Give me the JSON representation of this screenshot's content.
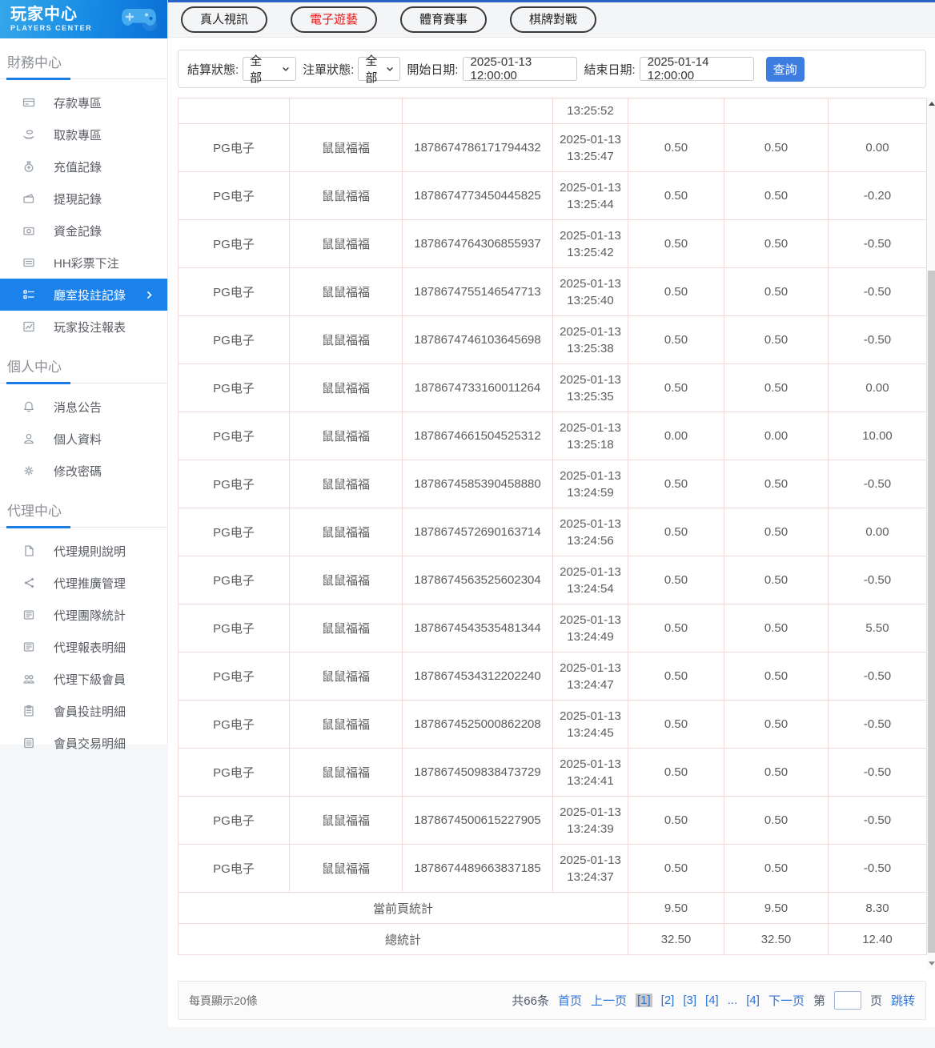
{
  "sidebar": {
    "title": "玩家中心",
    "subtitle": "PLAYERS CENTER",
    "logo_icon": "game-controller-icon",
    "sections": [
      {
        "label": "財務中心",
        "items": [
          {
            "icon": "deposit-card-icon",
            "label": "存款專區",
            "selected": false
          },
          {
            "icon": "withdraw-hand-icon",
            "label": "取款專區",
            "selected": false
          },
          {
            "icon": "recharge-bag-icon",
            "label": "充值記錄",
            "selected": false
          },
          {
            "icon": "withdraw-record-icon",
            "label": "提現記錄",
            "selected": false
          },
          {
            "icon": "funds-record-icon",
            "label": "資金記錄",
            "selected": false
          },
          {
            "icon": "lottery-bet-icon",
            "label": "HH彩票下注",
            "selected": false
          },
          {
            "icon": "bet-record-icon",
            "label": "廳室投註記錄",
            "selected": true
          },
          {
            "icon": "report-chart-icon",
            "label": "玩家投注報表",
            "selected": false
          }
        ]
      },
      {
        "label": "個人中心",
        "items": [
          {
            "icon": "bell-icon",
            "label": "消息公告",
            "selected": false
          },
          {
            "icon": "person-icon",
            "label": "個人資料",
            "selected": false
          },
          {
            "icon": "gear-icon",
            "label": "修改密碼",
            "selected": false
          }
        ]
      },
      {
        "label": "代理中心",
        "items": [
          {
            "icon": "doc-icon",
            "label": "代理規則說明",
            "selected": false
          },
          {
            "icon": "share-icon",
            "label": "代理推廣管理",
            "selected": false
          },
          {
            "icon": "news-icon",
            "label": "代理團隊統計",
            "selected": false
          },
          {
            "icon": "news-icon",
            "label": "代理報表明細",
            "selected": false
          },
          {
            "icon": "users-icon",
            "label": "代理下級會員",
            "selected": false
          },
          {
            "icon": "clipboard-icon",
            "label": "會員投註明細",
            "selected": false
          },
          {
            "icon": "clipboard2-icon",
            "label": "會員交易明細",
            "selected": false
          }
        ]
      }
    ]
  },
  "tabs": [
    {
      "label": "真人視訊",
      "active": false
    },
    {
      "label": "電子遊藝",
      "active": true
    },
    {
      "label": "體育賽事",
      "active": false
    },
    {
      "label": "棋牌對戰",
      "active": false
    }
  ],
  "filters": {
    "settle_status_label": "結算狀態:",
    "settle_status_value": "全部",
    "order_status_label": "注單狀態:",
    "order_status_value": "全部",
    "start_date_label": "開始日期:",
    "start_date_value": "2025-01-13 12:00:00",
    "end_date_label": "結束日期:",
    "end_date_value": "2025-01-14 12:00:00",
    "search_button": "查詢"
  },
  "table": {
    "partial_row_time": "13:25:52",
    "rows": [
      {
        "game": "PG电子",
        "name": "鼠鼠福福",
        "order_id": "1878674786171794432",
        "date": "2025-01-13",
        "time": "13:25:47",
        "bet": "0.50",
        "valid": "0.50",
        "win": "0.00"
      },
      {
        "game": "PG电子",
        "name": "鼠鼠福福",
        "order_id": "1878674773450445825",
        "date": "2025-01-13",
        "time": "13:25:44",
        "bet": "0.50",
        "valid": "0.50",
        "win": "-0.20"
      },
      {
        "game": "PG电子",
        "name": "鼠鼠福福",
        "order_id": "1878674764306855937",
        "date": "2025-01-13",
        "time": "13:25:42",
        "bet": "0.50",
        "valid": "0.50",
        "win": "-0.50"
      },
      {
        "game": "PG电子",
        "name": "鼠鼠福福",
        "order_id": "1878674755146547713",
        "date": "2025-01-13",
        "time": "13:25:40",
        "bet": "0.50",
        "valid": "0.50",
        "win": "-0.50"
      },
      {
        "game": "PG电子",
        "name": "鼠鼠福福",
        "order_id": "1878674746103645698",
        "date": "2025-01-13",
        "time": "13:25:38",
        "bet": "0.50",
        "valid": "0.50",
        "win": "-0.50"
      },
      {
        "game": "PG电子",
        "name": "鼠鼠福福",
        "order_id": "1878674733160011264",
        "date": "2025-01-13",
        "time": "13:25:35",
        "bet": "0.50",
        "valid": "0.50",
        "win": "0.00"
      },
      {
        "game": "PG电子",
        "name": "鼠鼠福福",
        "order_id": "1878674661504525312",
        "date": "2025-01-13",
        "time": "13:25:18",
        "bet": "0.00",
        "valid": "0.00",
        "win": "10.00"
      },
      {
        "game": "PG电子",
        "name": "鼠鼠福福",
        "order_id": "1878674585390458880",
        "date": "2025-01-13",
        "time": "13:24:59",
        "bet": "0.50",
        "valid": "0.50",
        "win": "-0.50"
      },
      {
        "game": "PG电子",
        "name": "鼠鼠福福",
        "order_id": "1878674572690163714",
        "date": "2025-01-13",
        "time": "13:24:56",
        "bet": "0.50",
        "valid": "0.50",
        "win": "0.00"
      },
      {
        "game": "PG电子",
        "name": "鼠鼠福福",
        "order_id": "1878674563525602304",
        "date": "2025-01-13",
        "time": "13:24:54",
        "bet": "0.50",
        "valid": "0.50",
        "win": "-0.50"
      },
      {
        "game": "PG电子",
        "name": "鼠鼠福福",
        "order_id": "1878674543535481344",
        "date": "2025-01-13",
        "time": "13:24:49",
        "bet": "0.50",
        "valid": "0.50",
        "win": "5.50"
      },
      {
        "game": "PG电子",
        "name": "鼠鼠福福",
        "order_id": "1878674534312202240",
        "date": "2025-01-13",
        "time": "13:24:47",
        "bet": "0.50",
        "valid": "0.50",
        "win": "-0.50"
      },
      {
        "game": "PG电子",
        "name": "鼠鼠福福",
        "order_id": "1878674525000862208",
        "date": "2025-01-13",
        "time": "13:24:45",
        "bet": "0.50",
        "valid": "0.50",
        "win": "-0.50"
      },
      {
        "game": "PG电子",
        "name": "鼠鼠福福",
        "order_id": "1878674509838473729",
        "date": "2025-01-13",
        "time": "13:24:41",
        "bet": "0.50",
        "valid": "0.50",
        "win": "-0.50"
      },
      {
        "game": "PG电子",
        "name": "鼠鼠福福",
        "order_id": "1878674500615227905",
        "date": "2025-01-13",
        "time": "13:24:39",
        "bet": "0.50",
        "valid": "0.50",
        "win": "-0.50"
      },
      {
        "game": "PG电子",
        "name": "鼠鼠福福",
        "order_id": "1878674489663837185",
        "date": "2025-01-13",
        "time": "13:24:37",
        "bet": "0.50",
        "valid": "0.50",
        "win": "-0.50"
      }
    ],
    "summary": [
      {
        "label": "當前頁統計",
        "values": [
          "9.50",
          "9.50",
          "8.30"
        ]
      },
      {
        "label": "總統計",
        "values": [
          "32.50",
          "32.50",
          "12.40"
        ]
      }
    ]
  },
  "footer": {
    "page_size_text": "每頁顯示20條",
    "total_text": "共66条",
    "first_label": "首页",
    "prev_label": "上一页",
    "pages": [
      "[1]",
      "[2]",
      "[3]",
      "[4]",
      "...",
      "[4]"
    ],
    "current_page_index": 0,
    "next_label": "下一页",
    "jump_prefix": "第",
    "jump_suffix": "页",
    "jump_button": "跳转",
    "jump_value": ""
  },
  "colors": {
    "sidebar_selected": "#1b82ec",
    "header_gradient_start": "#35a7ea",
    "header_gradient_end": "#0b6fd6",
    "tab_active_text": "#e41818",
    "search_button_bg": "#3d7de0",
    "table_border": "#f3d8d8",
    "pagination_link": "#2e73d6",
    "current_page_bg": "#c6c6c6"
  }
}
